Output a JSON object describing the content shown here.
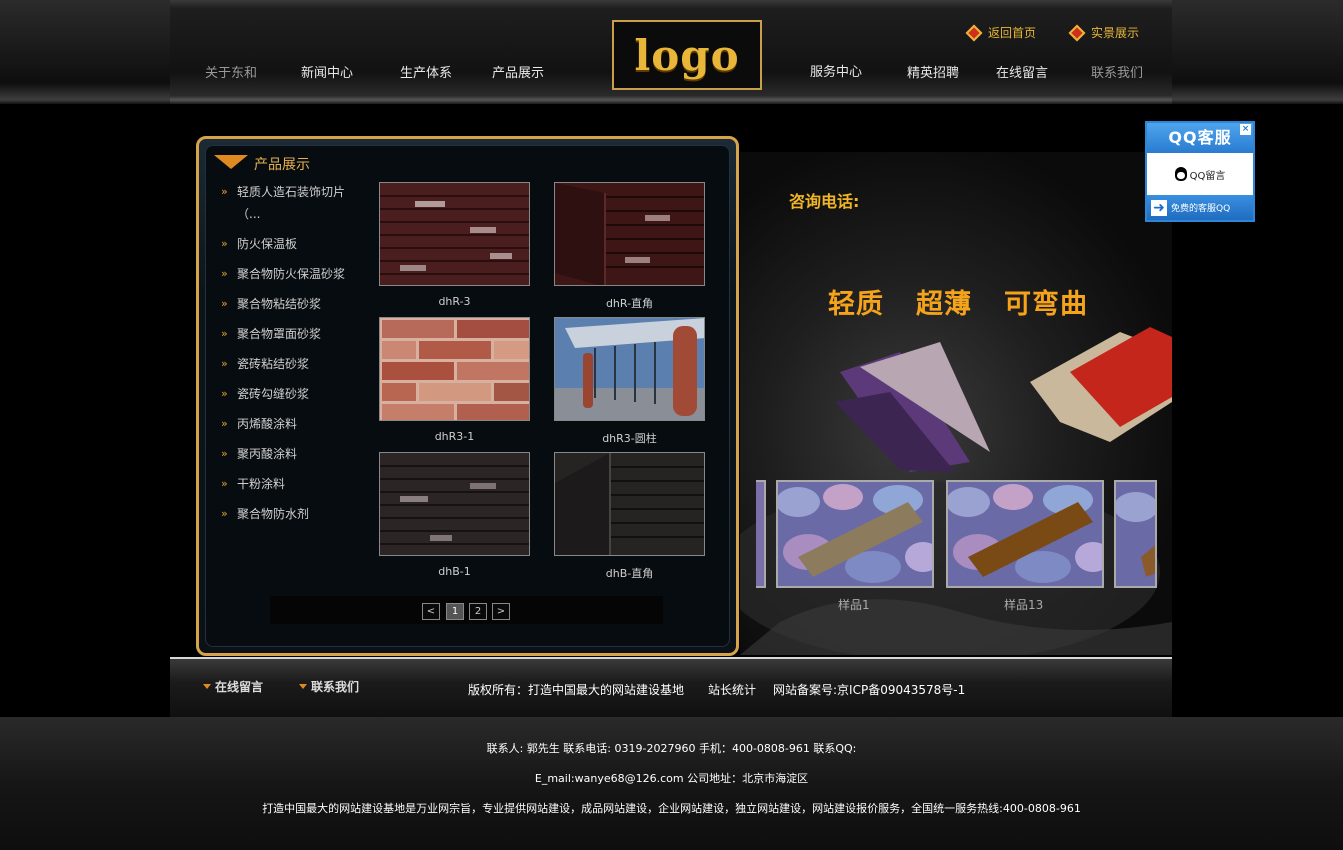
{
  "header": {
    "logo_text": "logo",
    "nav_left": [
      "关于东和",
      "新闻中心",
      "生产体系",
      "产品展示"
    ],
    "nav_right": [
      "服务中心",
      "精英招聘",
      "在线留言",
      "联系我们"
    ],
    "top_links": [
      "返回首页",
      "实景展示"
    ]
  },
  "panel": {
    "title": "产品展示",
    "categories": [
      "轻质人造石装饰切片（...",
      "防火保温板",
      "聚合物防火保温砂浆",
      "聚合物粘结砂浆",
      "聚合物罩面砂浆",
      "瓷砖粘结砂浆",
      "瓷砖勾缝砂浆",
      "丙烯酸涂料",
      "聚丙酸涂料",
      "干粉涂料",
      "聚合物防水剂"
    ],
    "products": [
      "dhR-3",
      "dhR-直角",
      "dhR3-1",
      "dhR3-圆柱",
      "dhB-1",
      "dhB-直角"
    ],
    "pager": {
      "prev": "<",
      "pages": [
        "1",
        "2"
      ],
      "next": ">",
      "current": "1"
    }
  },
  "banner": {
    "phone_label": "咨询电话:",
    "slogans": [
      "轻质",
      "超薄",
      "可弯曲"
    ],
    "slides": [
      "样品1",
      "样品13"
    ]
  },
  "qq": {
    "title": "QQ客服",
    "message": "QQ留言",
    "footer": "免费的客服QQ",
    "close": "×"
  },
  "footer": {
    "links": [
      "在线留言",
      "联系我们"
    ],
    "copyright": "版权所有：打造中国最大的网站建设基地",
    "stats": "站长统计",
    "icp": "网站备案号:京ICP备09043578号-1",
    "contact_line": "联系人: 郭先生   联系电话: 0319-2027960   手机：400-0808-961   联系QQ:",
    "email_line": "E_mail:wanye68@126.com   公司地址：北京市海淀区",
    "slogan_line": "打造中国最大的网站建设基地是万业网宗旨，专业提供网站建设，成品网站建设，企业网站建设，独立网站建设，网站建设报价服务，全国统一服务热线:400-0808-961"
  },
  "colors": {
    "accent": "#e5b24d",
    "brand_gold": "#d6a24a",
    "qq_blue": "#2e86d6"
  }
}
